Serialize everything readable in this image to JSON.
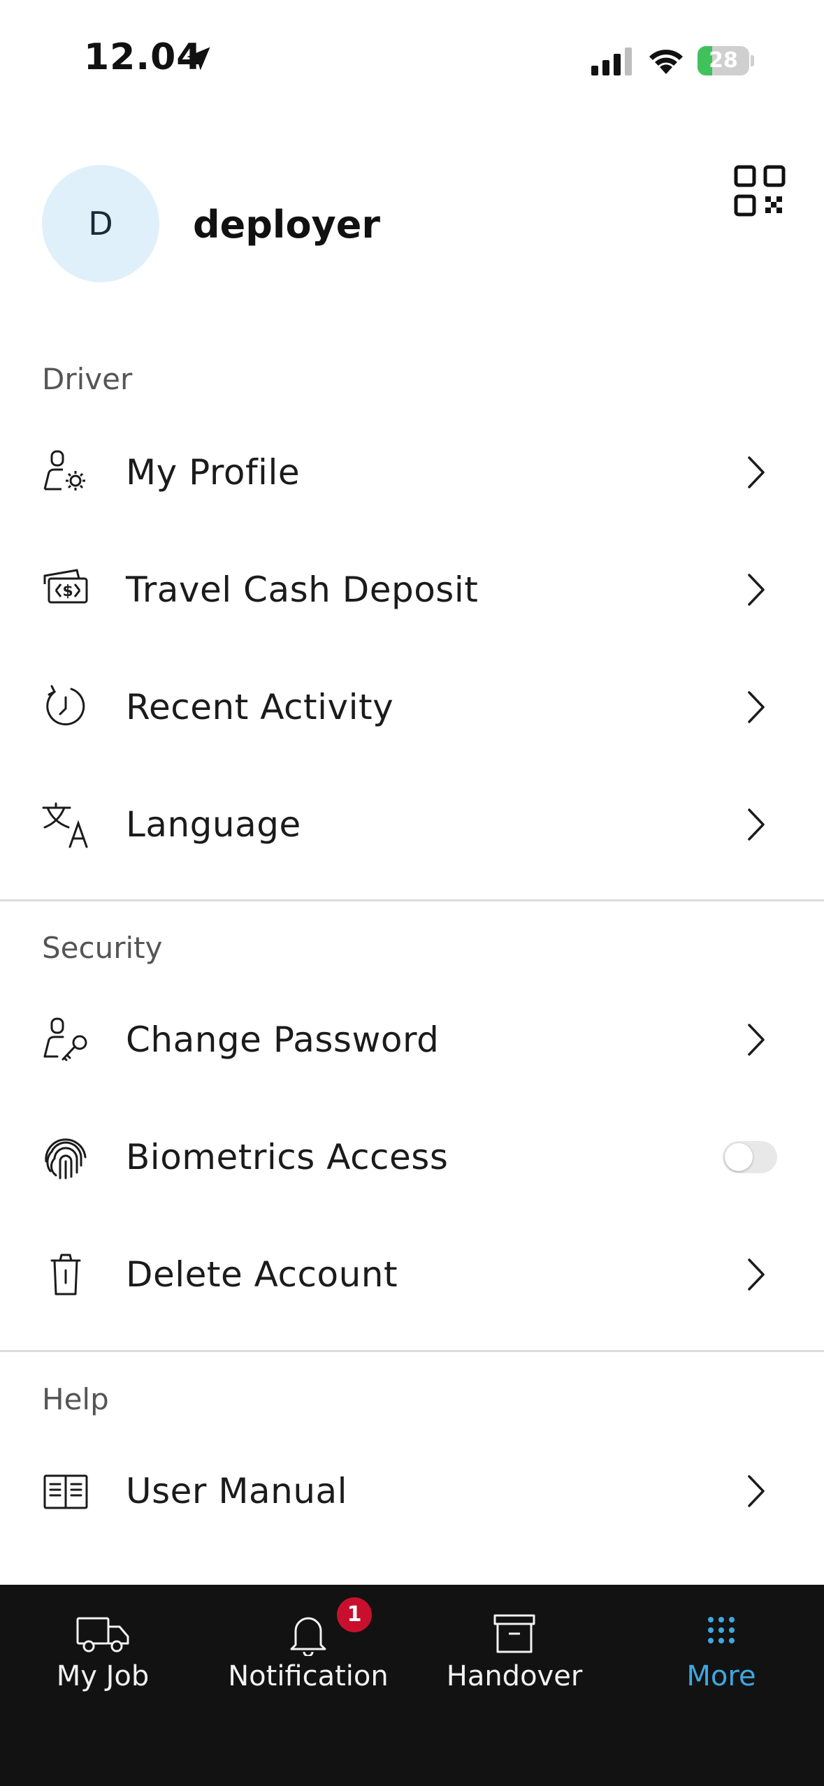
{
  "status_bar": {
    "time": "12.04",
    "battery_level": "28",
    "battery_fraction": 0.28,
    "icons": [
      "location-arrow-icon",
      "signal-icon",
      "wifi-icon",
      "battery-charging-icon"
    ]
  },
  "header": {
    "avatar_initial": "D",
    "username": "deployer",
    "qr_icon": "qr-code-icon"
  },
  "sections": {
    "driver": {
      "title": "Driver",
      "items": [
        {
          "label": "My Profile",
          "icon": "user-gear-icon"
        },
        {
          "label": "Travel Cash Deposit",
          "icon": "cash-icon"
        },
        {
          "label": "Recent Activity",
          "icon": "history-icon"
        },
        {
          "label": "Language",
          "icon": "translate-icon"
        }
      ]
    },
    "security": {
      "title": "Security",
      "items": [
        {
          "label": "Change Password",
          "icon": "user-key-icon"
        },
        {
          "label": "Biometrics Access",
          "icon": "fingerprint-icon",
          "toggle_on": false
        },
        {
          "label": "Delete Account",
          "icon": "trash-icon"
        }
      ]
    },
    "help": {
      "title": "Help",
      "items": [
        {
          "label": "User Manual",
          "icon": "book-icon"
        }
      ]
    }
  },
  "bottom_nav": {
    "items": [
      {
        "label": "My Job",
        "icon": "truck-icon"
      },
      {
        "label": "Notification",
        "icon": "bell-icon",
        "badge": "1"
      },
      {
        "label": "Handover",
        "icon": "archive-box-icon"
      },
      {
        "label": "More",
        "icon": "grid-dots-icon",
        "active": true
      }
    ]
  },
  "colors": {
    "accent": "#3ea8e0",
    "badge": "#c8102e",
    "nav_background": "#121212",
    "avatar_background": "#e0f0fa",
    "battery": "#3fc25a"
  }
}
